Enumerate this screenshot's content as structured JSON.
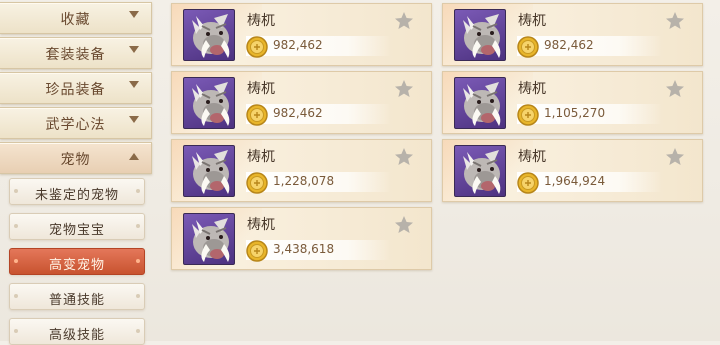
{
  "sidebar": {
    "categories": [
      {
        "label": "收藏",
        "expanded": false
      },
      {
        "label": "套装装备",
        "expanded": false
      },
      {
        "label": "珍品装备",
        "expanded": false
      },
      {
        "label": "武学心法",
        "expanded": false
      },
      {
        "label": "宠物",
        "expanded": true
      }
    ],
    "subitems": [
      {
        "label": "未鉴定的宠物",
        "active": false
      },
      {
        "label": "宠物宝宝",
        "active": false
      },
      {
        "label": "高变宠物",
        "active": true
      },
      {
        "label": "普通技能",
        "active": false
      },
      {
        "label": "高级技能",
        "active": false
      }
    ]
  },
  "listings": [
    {
      "name": "梼杌",
      "price": "982,462",
      "favorited": false,
      "icon": "boar-beast-portrait"
    },
    {
      "name": "梼杌",
      "price": "982,462",
      "favorited": false,
      "icon": "boar-beast-portrait"
    },
    {
      "name": "梼杌",
      "price": "982,462",
      "favorited": false,
      "icon": "boar-beast-portrait"
    },
    {
      "name": "梼杌",
      "price": "1,105,270",
      "favorited": false,
      "icon": "boar-beast-portrait"
    },
    {
      "name": "梼杌",
      "price": "1,228,078",
      "favorited": false,
      "icon": "boar-beast-portrait"
    },
    {
      "name": "梼杌",
      "price": "1,964,924",
      "favorited": false,
      "icon": "boar-beast-portrait"
    },
    {
      "name": "梼杌",
      "price": "3,438,618",
      "favorited": false,
      "icon": "boar-beast-portrait"
    }
  ],
  "colors": {
    "active_tab": "#d4603d",
    "price_text": "#7a5a3a",
    "coin": "#e8b52a"
  }
}
